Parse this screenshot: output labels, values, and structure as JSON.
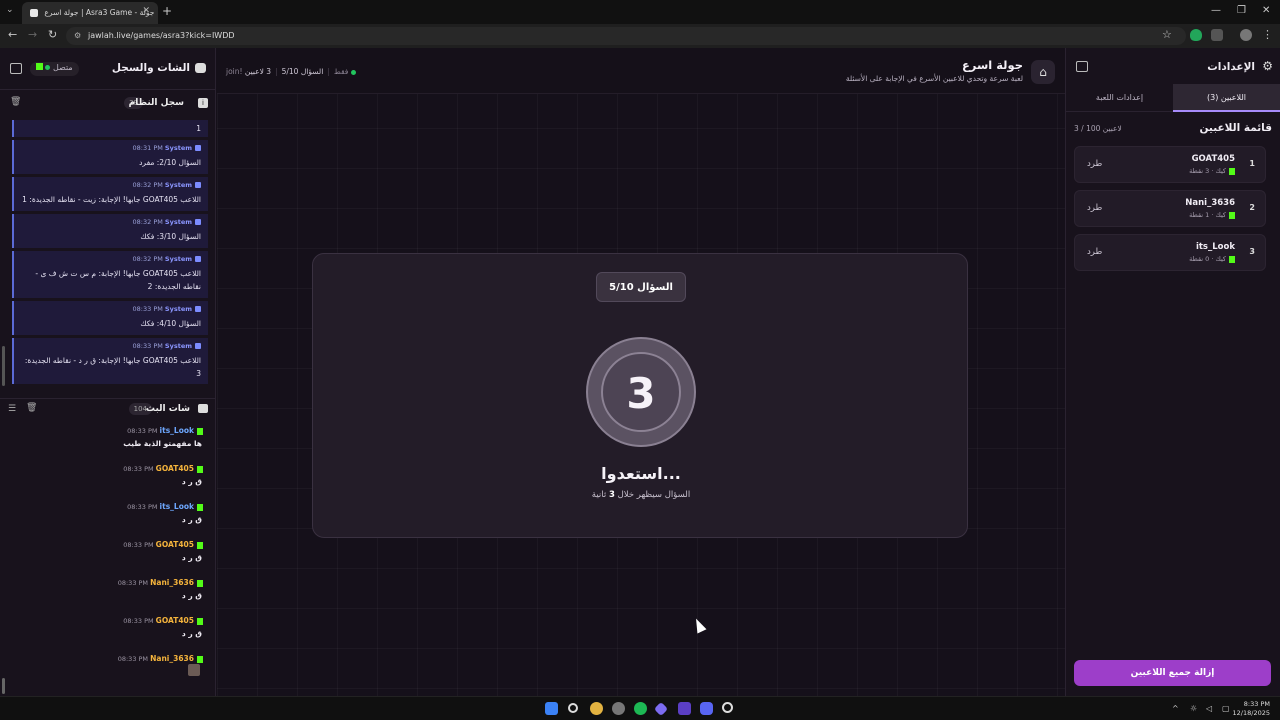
{
  "browser": {
    "tab_title": "جولة اسرع | Asra3 Game - جولة",
    "url": "jawlah.live/games/asra3?kick=IWDD"
  },
  "chat_panel": {
    "title": "الشات والسجل",
    "status": "متصل",
    "system_log": {
      "title": "سجل النظام",
      "count": "39",
      "items": [
        {
          "meta": "",
          "text": "1"
        },
        {
          "name": "System",
          "time": "08:31 PM",
          "text": "السؤال 2/10: مفرد"
        },
        {
          "name": "System",
          "time": "08:32 PM",
          "text": "اللاعب GOAT405 جابها! الإجابة: زيت - نقاطه الجديدة: 1"
        },
        {
          "name": "System",
          "time": "08:32 PM",
          "text": "السؤال 3/10: فكك"
        },
        {
          "name": "System",
          "time": "08:32 PM",
          "text": "اللاعب GOAT405 جابها! الإجابة: م س ت ش ف ى - نقاطه الجديدة: 2"
        },
        {
          "name": "System",
          "time": "08:33 PM",
          "text": "السؤال 4/10: فكك"
        },
        {
          "name": "System",
          "time": "08:33 PM",
          "text": "اللاعب GOAT405 جابها! الإجابة: ق ر د - نقاطه الجديدة: 3"
        }
      ]
    },
    "stream_chat": {
      "title": "شات البث",
      "count": "104",
      "messages": [
        {
          "user": "its_Look",
          "color": "#6ea8ff",
          "time": "08:33 PM",
          "text": "ها مفهمتو الذبة طيب"
        },
        {
          "user": "GOAT405",
          "color": "#f5b43c",
          "time": "08:33 PM",
          "text": "ق ر د"
        },
        {
          "user": "its_Look",
          "color": "#6ea8ff",
          "time": "08:33 PM",
          "text": "ق ر د"
        },
        {
          "user": "GOAT405",
          "color": "#f5b43c",
          "time": "08:33 PM",
          "text": "ق ر د"
        },
        {
          "user": "Nani_3636",
          "color": "#f5b43c",
          "time": "08:33 PM",
          "text": "ق ر د"
        },
        {
          "user": "GOAT405",
          "color": "#f5b43c",
          "time": "08:33 PM",
          "text": "ق ر د"
        },
        {
          "user": "Nani_3636",
          "color": "#f5b43c",
          "time": "08:33 PM",
          "text": ""
        }
      ]
    }
  },
  "game": {
    "title": "جولة اسرع",
    "subtitle": "لعبة سرعة وتحدي للاعبين الأسرع في الإجابة على الأسئلة",
    "players_online": "3 لاعبين",
    "question_progress": "السؤال 5/10",
    "join_mode": "join! فقط",
    "question_badge": "السؤال 5/10",
    "countdown": "3",
    "ready_text": "استعدوا...",
    "soon_prefix": "السؤال سيظهر خلال",
    "soon_seconds": "3",
    "soon_suffix": "ثانية"
  },
  "settings": {
    "title": "الإعدادات",
    "tabs": [
      {
        "label": "اللاعبين (3)",
        "active": true
      },
      {
        "label": "إعدادات اللعبة",
        "active": false
      }
    ],
    "players_title": "قائمة اللاعبين",
    "players_count": "3 / 100 لاعبين",
    "players": [
      {
        "rank": "1",
        "name": "GOAT405",
        "sub": "كيك · 3 نقطة",
        "kick": "طرد"
      },
      {
        "rank": "2",
        "name": "Nani_3636",
        "sub": "كيك · 1 نقطة",
        "kick": "طرد"
      },
      {
        "rank": "3",
        "name": "its_Look",
        "sub": "كيك · 0 نقطة",
        "kick": "طرد"
      }
    ],
    "remove_all": "إزالة جميع اللاعبين"
  },
  "taskbar": {
    "time": "8:33 PM",
    "date": "12/18/2025"
  }
}
